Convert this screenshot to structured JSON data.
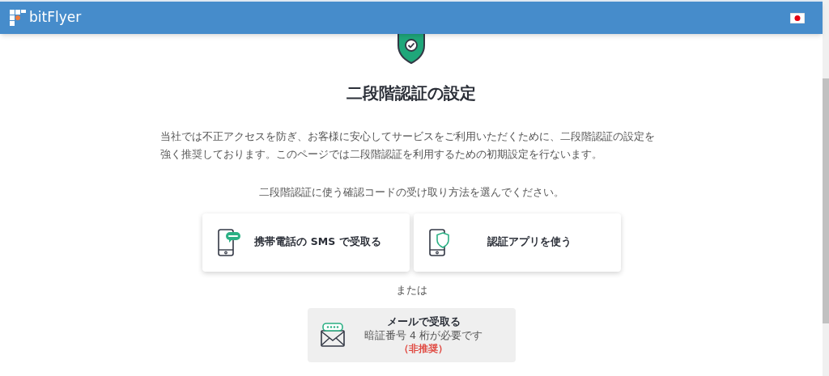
{
  "header": {
    "logo": "bitFlyer"
  },
  "title": "二段階認証の設定",
  "intro": "当社では不正アクセスを防ぎ、お客様に安心してサービスをご利用いただくために、二段階認証の設定を強く推奨しております。このページでは二段階認証を利用するための初期設定を行ないます。",
  "prompt": "二段階認証に使う確認コードの受け取り方法を選んでください。",
  "options": [
    {
      "kind": "sms",
      "label": "携帯電話の SMS で受取る"
    },
    {
      "kind": "app",
      "label": "認証アプリを使う"
    }
  ],
  "separator": "または",
  "email_option": {
    "title": "メールで受取る",
    "note": "暗証番号 4 桁が必要です",
    "warning": "（非推奨）"
  }
}
